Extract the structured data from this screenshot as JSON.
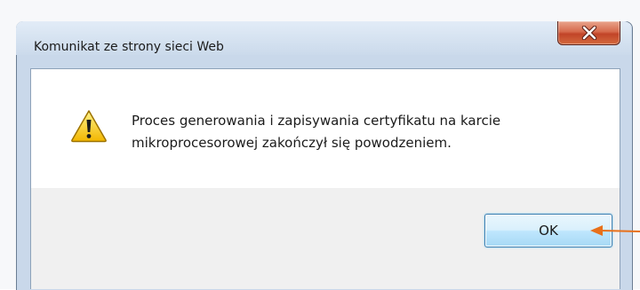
{
  "dialog": {
    "title": "Komunikat ze strony sieci Web",
    "message_line1": "Proces generowania i zapisywania certyfikatu na karcie",
    "message_line2": "mikroprocesorowej zakończył się powodzeniem.",
    "ok_label": "OK",
    "icon": "warning-icon",
    "close_icon": "close-icon"
  },
  "annotation": {
    "arrow_color": "#e8701a",
    "points_to": "ok-button"
  }
}
